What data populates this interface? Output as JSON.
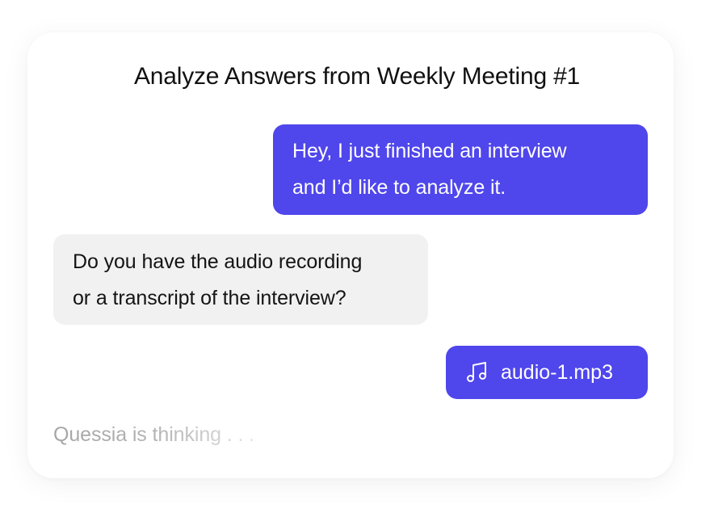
{
  "chat": {
    "title": "Analyze Answers from Weekly Meeting #1",
    "messages": [
      {
        "role": "user",
        "lines": [
          "Hey, I just finished an interview",
          "and I’d like to analyze it."
        ]
      },
      {
        "role": "assistant",
        "lines": [
          "Do you have the audio recording",
          "or a transcript of the interview?"
        ]
      }
    ],
    "attachment": {
      "icon": "music-note-icon",
      "filename": "audio-1.mp3"
    },
    "status": "Quessia is thinking . . ."
  },
  "colors": {
    "user_bubble": "#4f46ec",
    "assistant_bubble": "#f1f1f1",
    "background": "#ffffff"
  }
}
